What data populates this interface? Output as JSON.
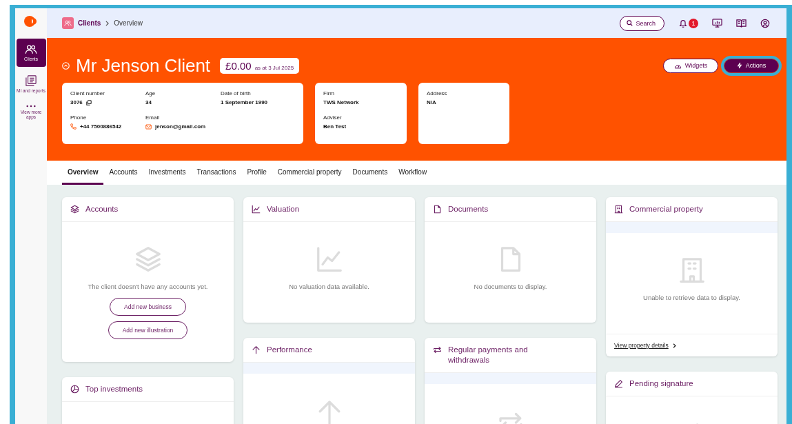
{
  "sidebar": {
    "items": [
      {
        "label": "Clients",
        "selected": true
      },
      {
        "label": "MI and reports",
        "selected": false
      },
      {
        "label": "View more apps",
        "selected": false
      }
    ]
  },
  "breadcrumb": [
    {
      "label": "Clients"
    },
    {
      "label": "Overview"
    }
  ],
  "topbar": {
    "search": "Search",
    "notifications": "1"
  },
  "client": {
    "name": "Mr Jenson Client",
    "balance": "£0.00",
    "balance_date": "as at 3 Jul 2025"
  },
  "header_buttons": [
    {
      "label": "Widgets",
      "kind": "outline",
      "highlighted": false
    },
    {
      "label": "Actions",
      "kind": "primary",
      "highlighted": true
    }
  ],
  "info_cards": [
    {
      "fields": [
        {
          "label": "Client number",
          "value": "3076"
        },
        {
          "label": "Age",
          "value": "34"
        },
        {
          "label": "Date of birth",
          "value": "1 September 1990"
        },
        {
          "label": "Phone",
          "value": "+44 7500886542"
        },
        {
          "label": "Email",
          "value": "jenson@gmail.com"
        }
      ]
    },
    {
      "fields": [
        {
          "label": "Firm",
          "value": "TWS Network"
        },
        {
          "label": "Adviser",
          "value": "Ben Test"
        }
      ]
    },
    {
      "fields": [
        {
          "label": "Address",
          "value": "N/A"
        }
      ]
    }
  ],
  "tabs": [
    {
      "label": "Overview",
      "selected": true
    },
    {
      "label": "Accounts",
      "selected": false
    },
    {
      "label": "Investments",
      "selected": false
    },
    {
      "label": "Transactions",
      "selected": false
    },
    {
      "label": "Profile",
      "selected": false
    },
    {
      "label": "Commercial property",
      "selected": false
    },
    {
      "label": "Documents",
      "selected": false
    },
    {
      "label": "Workflow",
      "selected": false
    }
  ],
  "widget_columns": [
    {
      "cards": [
        {
          "title": "Accounts",
          "band": false,
          "message": "The client doesn't have any accounts yet.",
          "buttons": [
            "Add new business",
            "Add new illustration"
          ]
        },
        {
          "title": "Top investments",
          "band": false
        }
      ]
    },
    {
      "cards": [
        {
          "title": "Valuation",
          "band": false,
          "message": "No valuation data available."
        },
        {
          "title": "Performance",
          "band": true
        }
      ]
    },
    {
      "cards": [
        {
          "title": "Documents",
          "band": false,
          "message": "No documents to display."
        },
        {
          "title": "Regular payments and withdrawals",
          "band": true
        }
      ]
    },
    {
      "cards": [
        {
          "title": "Commercial property",
          "band": true,
          "message": "Unable to retrieve data to display.",
          "link": "View property details"
        },
        {
          "title": "Pending signature",
          "band": false
        }
      ]
    }
  ]
}
